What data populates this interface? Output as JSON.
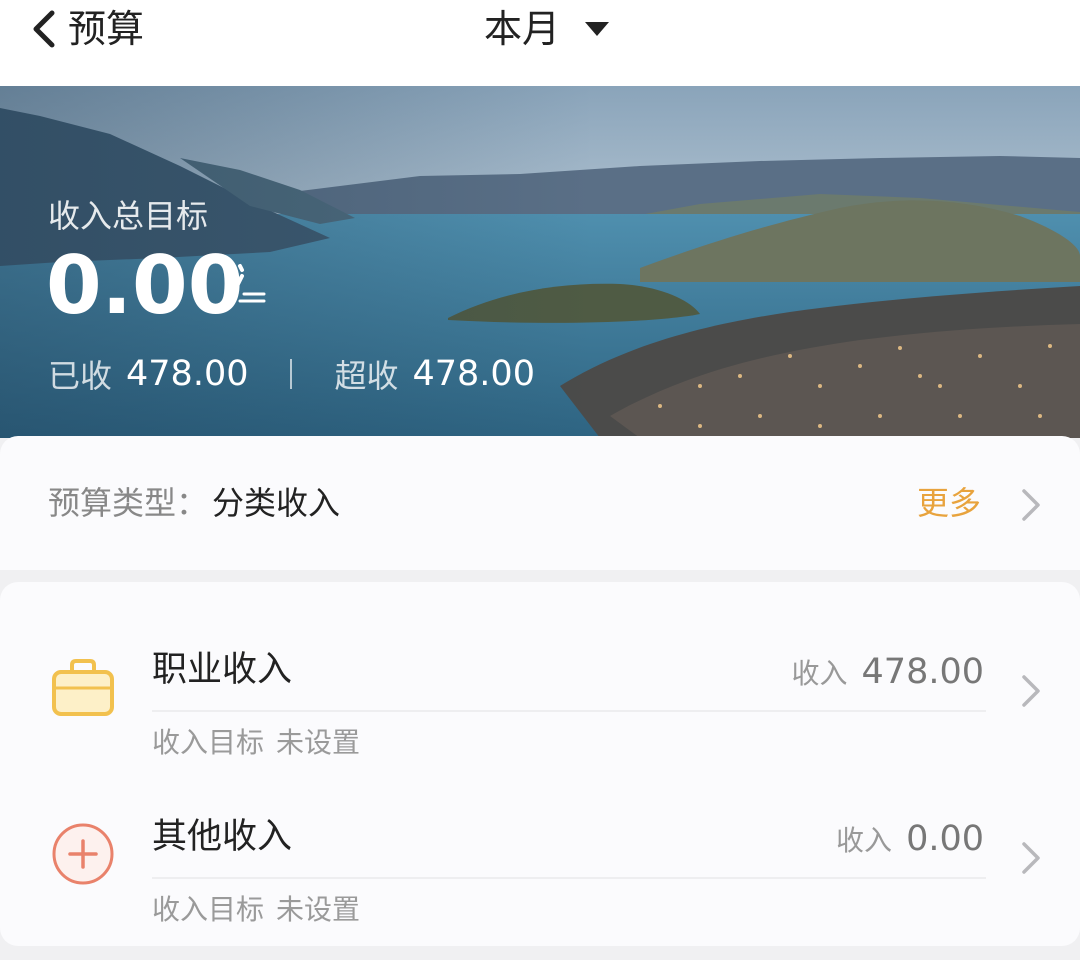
{
  "nav": {
    "back_label": "预算",
    "period_label": "本月"
  },
  "hero": {
    "label": "收入总目标",
    "amount": "0.00",
    "received_label": "已收",
    "received_value": "478.00",
    "over_label": "超收",
    "over_value": "478.00"
  },
  "budget_type": {
    "label": "预算类型：",
    "value": "分类收入",
    "more_label": "更多"
  },
  "categories": [
    {
      "name": "职业收入",
      "icon": "briefcase-icon",
      "icon_color": "#f2c14e",
      "amount_label": "收入",
      "amount": "478.00",
      "target_label": "收入目标",
      "target_value": "未设置"
    },
    {
      "name": "其他收入",
      "icon": "plus-circle-icon",
      "icon_color": "#e9826b",
      "amount_label": "收入",
      "amount": "0.00",
      "target_label": "收入目标",
      "target_value": "未设置"
    }
  ],
  "colors": {
    "accent": "#e8a33d",
    "lake": "#3f7fa0"
  }
}
